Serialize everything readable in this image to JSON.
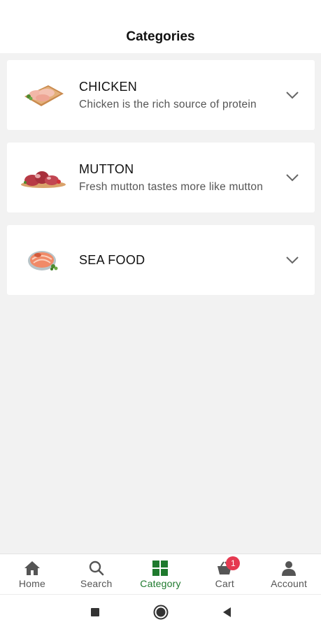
{
  "header": {
    "title": "Categories"
  },
  "categories": [
    {
      "name": "CHICKEN",
      "description": "Chicken is the rich source of protein",
      "image": "chicken-image"
    },
    {
      "name": "MUTTON",
      "description": "Fresh mutton tastes more like mutton",
      "image": "mutton-image"
    },
    {
      "name": "SEA FOOD",
      "description": "",
      "image": "seafood-image"
    }
  ],
  "bottom_nav": {
    "items": [
      {
        "label": "Home",
        "icon": "home-icon"
      },
      {
        "label": "Search",
        "icon": "search-icon"
      },
      {
        "label": "Category",
        "icon": "grid-icon",
        "active": true
      },
      {
        "label": "Cart",
        "icon": "cart-icon",
        "badge": "1"
      },
      {
        "label": "Account",
        "icon": "account-icon"
      }
    ]
  },
  "colors": {
    "active": "#1f7a2e",
    "badge": "#e53950",
    "background": "#f2f2f2"
  }
}
